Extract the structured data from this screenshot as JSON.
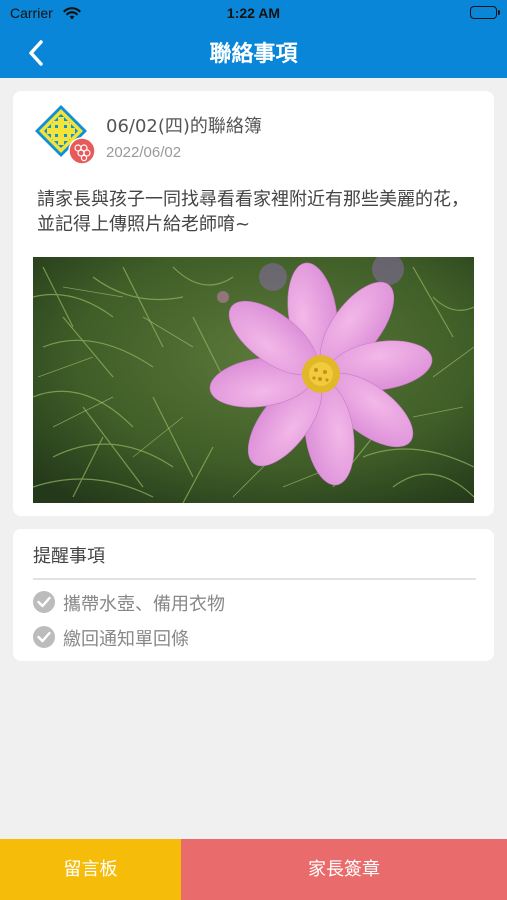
{
  "status_bar": {
    "carrier": "Carrier",
    "time": "1:22 AM",
    "wifi_icon": "wifi-icon",
    "battery_icon": "battery-icon"
  },
  "nav": {
    "title": "聯絡事項",
    "back_icon": "chevron-left-icon"
  },
  "notice": {
    "avatar_icon": "school-logo-icon",
    "badge_icon": "grapes-badge-icon",
    "subject": "06/02(四)的聯絡簿",
    "date": "2022/06/02",
    "message": "請家長與孩子一同找尋看看家裡附近有那些美麗的花，並記得上傳照片給老師唷~",
    "photo_subject": "pink-cosmos-flower"
  },
  "reminders": {
    "title": "提醒事項",
    "items": [
      {
        "label": "攜帶水壺、備用衣物",
        "icon": "check-circle-icon"
      },
      {
        "label": "繳回通知單回條",
        "icon": "check-circle-icon"
      }
    ]
  },
  "bottom": {
    "message_board_label": "留言板",
    "parent_sign_label": "家長簽章"
  },
  "colors": {
    "nav_blue": "#0a86d8",
    "message_board_yellow": "#f5bc0a",
    "parent_sign_red": "#ea6b6b",
    "background": "#f0f0f0"
  }
}
